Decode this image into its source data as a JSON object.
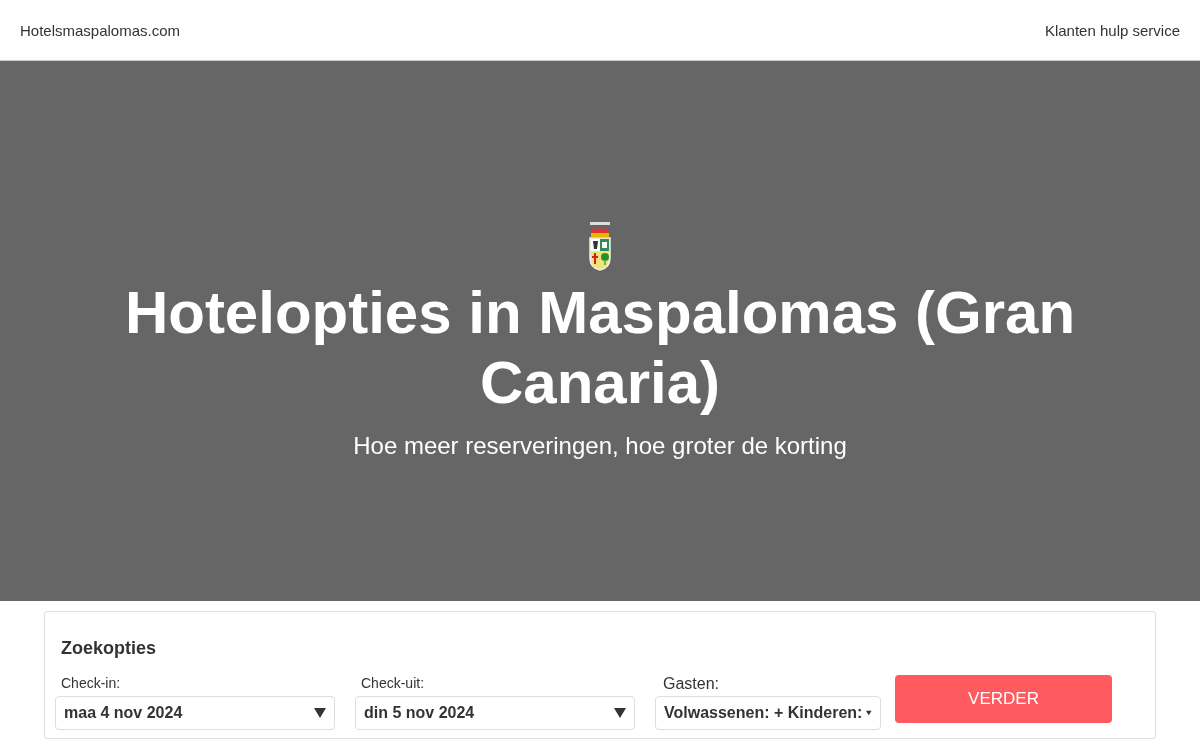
{
  "header": {
    "brand": "Hotelsmaspalomas.com",
    "link": "Klanten hulp service"
  },
  "hero": {
    "title": "Hotelopties in Maspalomas (Gran Canaria)",
    "subtitle": "Hoe meer reserveringen, hoe groter de korting"
  },
  "search": {
    "title": "Zoekopties",
    "fields": [
      {
        "label": "Check-in:",
        "value": "maa 4 nov 2024"
      },
      {
        "label": "Check-uit:",
        "value": "din 5 nov 2024"
      },
      {
        "label": "Gasten:",
        "value": "Volwassenen: + Kinderen:"
      }
    ],
    "button": "VERDER"
  }
}
